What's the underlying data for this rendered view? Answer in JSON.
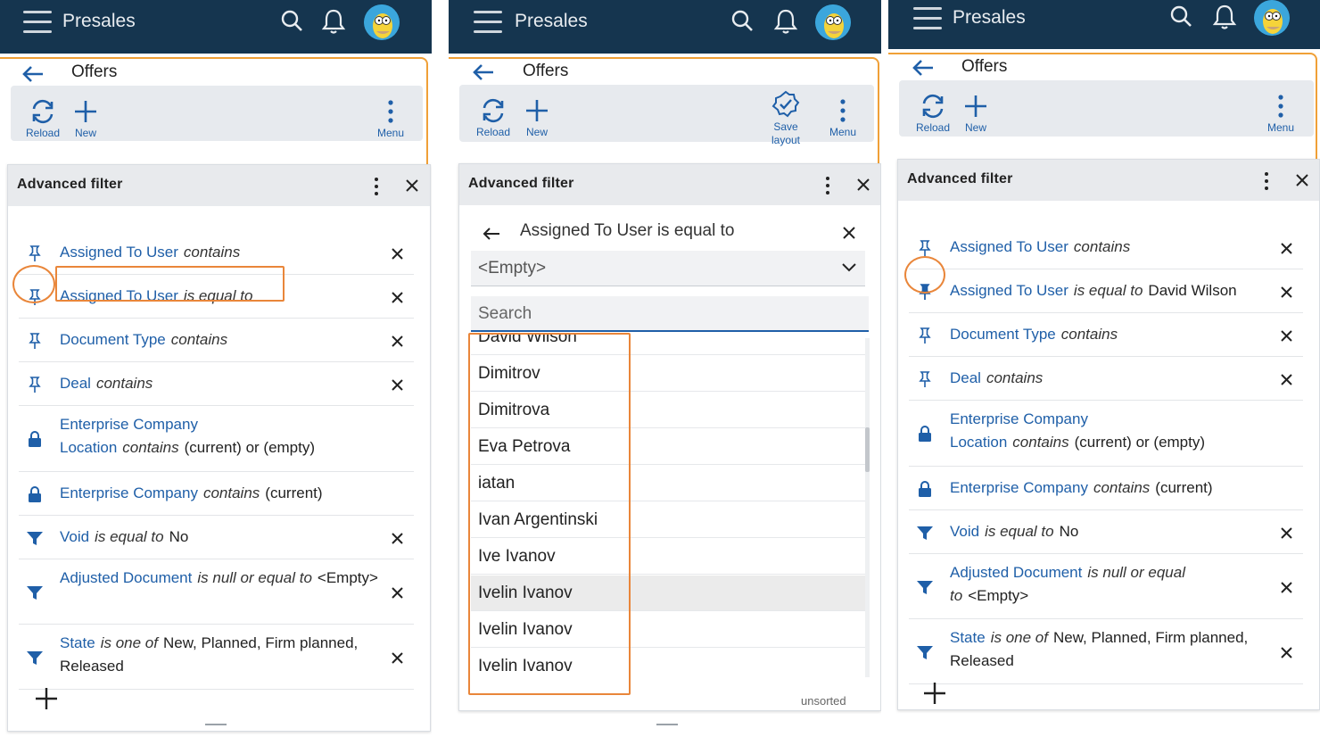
{
  "app": {
    "title": "Presales"
  },
  "page": {
    "title": "Offers"
  },
  "toolbar": {
    "reload": "Reload",
    "new": "New",
    "menu": "Menu",
    "save_layout_1": "Save",
    "save_layout_2": "layout"
  },
  "filter": {
    "title": "Advanced filter"
  },
  "panel1": {
    "rows": [
      {
        "field": "Assigned To User",
        "op": "contains",
        "value": "",
        "icon": "pin-icon"
      },
      {
        "field": "Assigned To User",
        "op": "is equal to",
        "value": "",
        "icon": "pin-icon"
      },
      {
        "field": "Document Type",
        "op": "contains",
        "value": "",
        "icon": "pin-icon"
      },
      {
        "field": "Deal",
        "op": "contains",
        "value": "",
        "icon": "pin-icon"
      },
      {
        "field": "Enterprise Company Location",
        "op": "contains",
        "value": "(current) or (empty)",
        "icon": "lock-icon"
      },
      {
        "field": "Enterprise Company",
        "op": "contains",
        "value": "(current)",
        "icon": "lock-icon"
      },
      {
        "field": "Void",
        "op": "is equal to",
        "value": "No",
        "icon": "funnel-icon"
      },
      {
        "field": "Adjusted Document",
        "op": "is null or equal to",
        "value": "<Empty>",
        "icon": "funnel-icon"
      },
      {
        "field": "State",
        "op": "is one of",
        "value": "New, Planned, Firm planned, Released",
        "icon": "funnel-icon"
      }
    ]
  },
  "panel2": {
    "editor_title": "Assigned To User is equal to",
    "selected": "<Empty>",
    "search_placeholder": "Search",
    "sort_label": "unsorted",
    "users": [
      "David Wilson",
      "Dimitrov",
      "Dimitrova",
      "Eva Petrova",
      "iatan",
      "Ivan Argentinski",
      "Ive Ivanov",
      "Ivelin Ivanov",
      "Ivelin Ivanov",
      "Ivelin Ivanov"
    ]
  },
  "panel3": {
    "rows": [
      {
        "field": "Assigned To User",
        "op": "contains",
        "value": "",
        "icon": "pin-icon"
      },
      {
        "field": "Assigned To User",
        "op": "is equal to",
        "value": "David Wilson",
        "icon": "pin-filled-icon"
      },
      {
        "field": "Document Type",
        "op": "contains",
        "value": "",
        "icon": "pin-icon"
      },
      {
        "field": "Deal",
        "op": "contains",
        "value": "",
        "icon": "pin-icon"
      },
      {
        "field": "Enterprise Company Location",
        "op": "contains",
        "value": "(current) or (empty)",
        "icon": "lock-icon"
      },
      {
        "field": "Enterprise Company",
        "op": "contains",
        "value": "(current)",
        "icon": "lock-icon"
      },
      {
        "field": "Void",
        "op": "is equal to",
        "value": "No",
        "icon": "funnel-icon"
      },
      {
        "field": "Adjusted Document",
        "op": "is null or equal to",
        "value": "<Empty>",
        "icon": "funnel-icon"
      },
      {
        "field": "State",
        "op": "is one of",
        "value": "New, Planned, Firm planned, Released",
        "icon": "funnel-icon"
      }
    ]
  },
  "colors": {
    "navy": "#15354f",
    "link": "#1f5fa8",
    "highlight": "#e9863a",
    "accent_frame": "#f0a037"
  }
}
